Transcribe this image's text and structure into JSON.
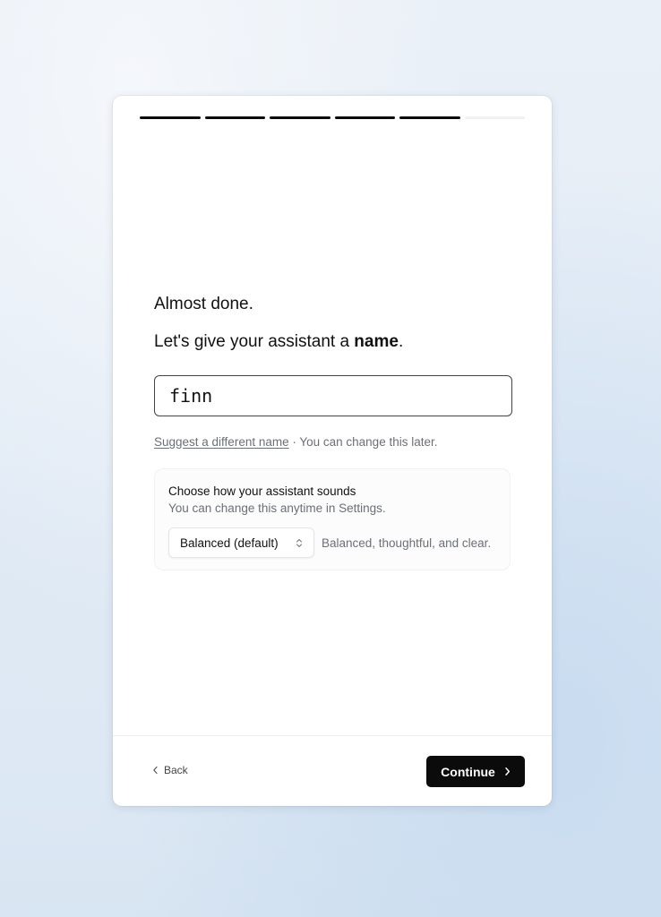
{
  "progress": {
    "total_steps": 6,
    "completed_steps": 5
  },
  "onboarding": {
    "heading": "Almost done.",
    "prompt_prefix": "Let's give your assistant a ",
    "prompt_bold": "name",
    "prompt_suffix": ".",
    "name_value": "finn",
    "suggest_link": "Suggest a different name",
    "change_later": " · You can change this later."
  },
  "voice": {
    "title": "Choose how your assistant sounds",
    "subtitle": "You can change this anytime in Settings.",
    "selected": "Balanced (default)",
    "description": "Balanced, thoughtful, and clear."
  },
  "footer": {
    "back_label": "Back",
    "continue_label": "Continue"
  },
  "icons": {
    "back": "chevron-left-icon",
    "continue": "chevron-right-icon",
    "select": "chevron-up-down-icon"
  },
  "colors": {
    "primary_button": "#0b0b0b",
    "progress_done": "#0b0b0b",
    "progress_todo": "#f0f1f3"
  }
}
